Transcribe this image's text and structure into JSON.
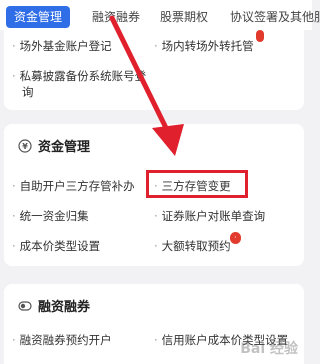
{
  "tabs": [
    {
      "label": "资金管理"
    },
    {
      "label": "融资融券"
    },
    {
      "label": "股票期权"
    },
    {
      "label": "协议签署及其他服"
    }
  ],
  "top_card": {
    "items": [
      {
        "label": "场外基金账户登记"
      },
      {
        "label": "场内转场外转托管"
      },
      {
        "label": "私募披露备份系统账号登"
      },
      {
        "label": "询"
      }
    ]
  },
  "fund_section": {
    "title": "资金管理",
    "items": [
      {
        "label": "自助开户三方存管补办"
      },
      {
        "label": "三方存管变更"
      },
      {
        "label": "统一资金归集"
      },
      {
        "label": "证券账户对账单查询"
      },
      {
        "label": "成本价类型设置"
      },
      {
        "label": "大额转取预约"
      }
    ],
    "badge": "·"
  },
  "margin_section": {
    "title": "融资融券",
    "items": [
      {
        "label": "融资融券预约开户"
      },
      {
        "label": "信用账户成本价类型设置"
      }
    ]
  },
  "watermark": "Bai 经验",
  "colors": {
    "accent": "#2f6ee6",
    "annotation": "#e0212d",
    "badge": "#e23b2e"
  }
}
